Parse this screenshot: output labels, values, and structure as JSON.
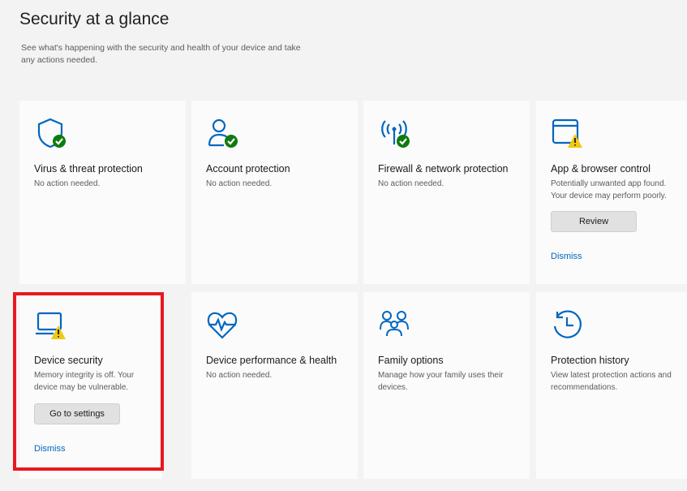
{
  "page": {
    "title": "Security at a glance",
    "subtitle": "See what's happening with the security and health of your device and take any actions needed."
  },
  "tiles": [
    {
      "name": "Virus & threat protection",
      "status": "No action needed.",
      "icon": "shield-check-icon"
    },
    {
      "name": "Account protection",
      "status": "No action needed.",
      "icon": "person-check-icon"
    },
    {
      "name": "Firewall & network protection",
      "status": "No action needed.",
      "icon": "antenna-check-icon"
    },
    {
      "name": "App & browser control",
      "status": "Potentially unwanted app found.\nYour device may perform poorly.",
      "icon": "browser-warning-icon",
      "button": "Review",
      "link": "Dismiss"
    },
    {
      "name": "Device security",
      "status": "Memory integrity is off. Your device may be vulnerable.",
      "icon": "laptop-warning-icon",
      "button": "Go to settings",
      "link": "Dismiss"
    },
    {
      "name": "Device performance & health",
      "status": "No action needed.",
      "icon": "heart-pulse-icon"
    },
    {
      "name": "Family options",
      "status": "Manage how your family uses their devices.",
      "icon": "family-icon"
    },
    {
      "name": "Protection history",
      "status": "View latest protection actions and recommendations.",
      "icon": "history-clock-icon"
    }
  ],
  "colors": {
    "accent": "#0067c0",
    "ok": "#0f7b0f",
    "warning": "#f2c811",
    "highlight": "#e8181e"
  }
}
